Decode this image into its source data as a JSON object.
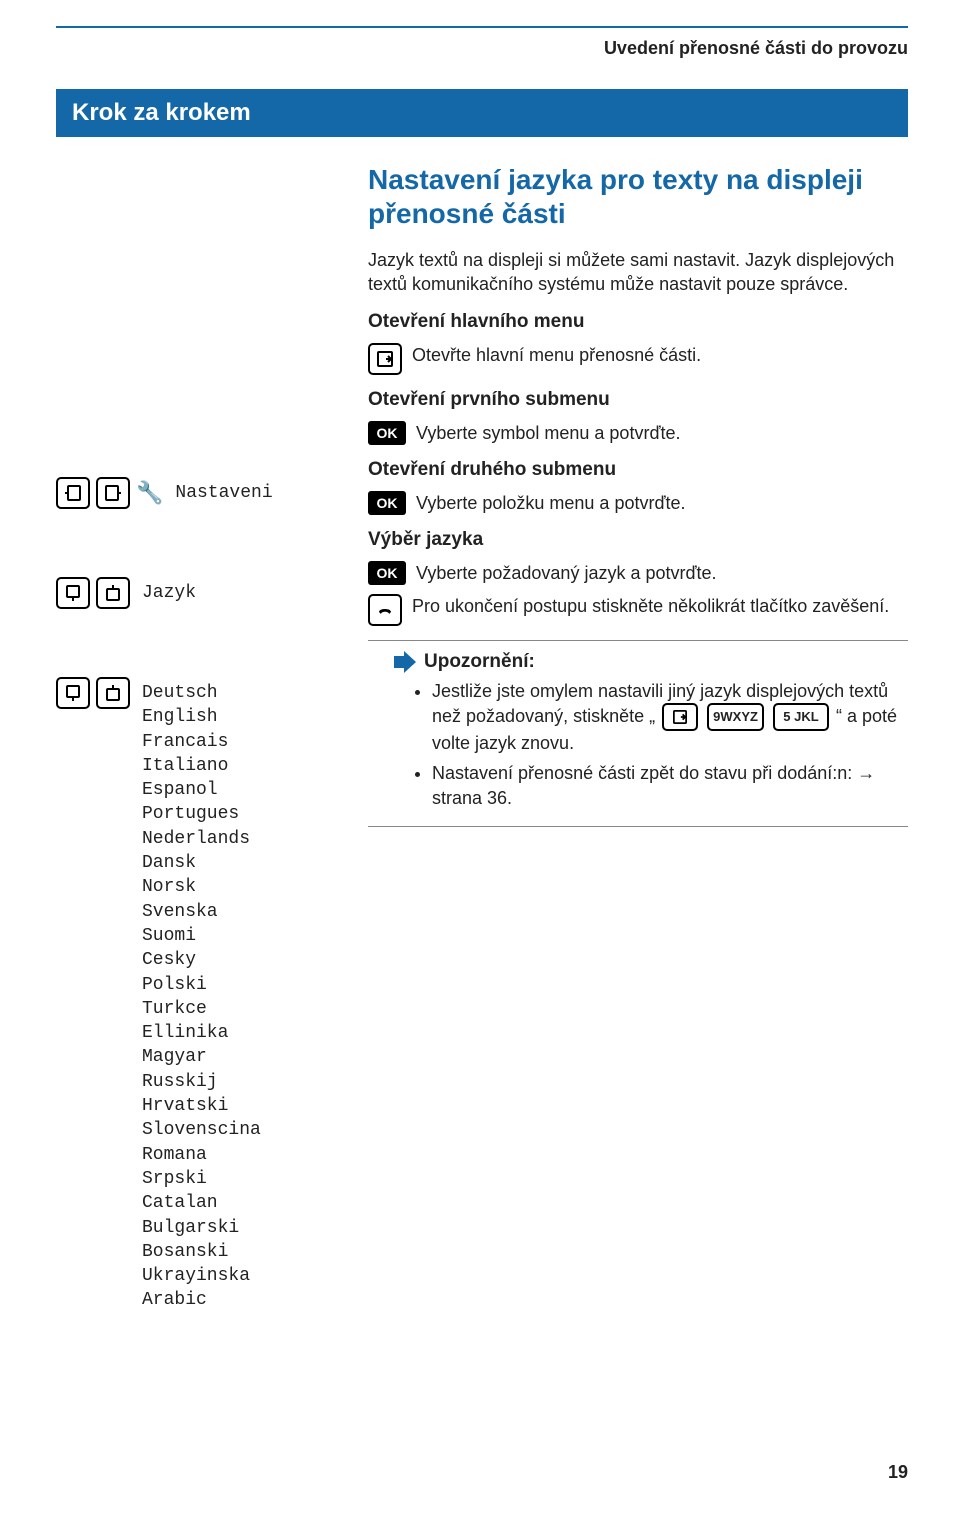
{
  "running_head": "Uvedení přenosné části do provozu",
  "step_banner": "Krok za krokem",
  "title": "Nastavení jazyka pro texty na displeji přenosné části",
  "intro_a": "Jazyk textů na displeji si můžete sami nastavit. Jazyk displejových textů komunikačního systému může nastavit pouze správce.",
  "sec_open_main": "Otevření hlavního menu",
  "open_main_instr": "Otevřte hlavní menu přenosné části.",
  "sec_open_sub1": "Otevření prvního submenu",
  "sub1_instr": "Vyberte symbol menu a potvrďte.",
  "nav_nastaveni": "Nastaveni",
  "sec_open_sub2": "Otevření druhého submenu",
  "nav_jazyk": "Jazyk",
  "sub2_instr": "Vyberte položku menu a potvrďte.",
  "sec_vyber": "Výběr jazyka",
  "vyber_instr": "Vyberte požadovaný jazyk a potvrďte.",
  "end_instr": "Pro ukončení postupu stiskněte několikrát tlačítko zavěšení.",
  "note_title": "Upozornění:",
  "note_b1_a": "Jestliže jste omylem nastavili jiný jazyk displejových textů než požadovaný, stiskněte „",
  "note_b1_b": "“ a poté volte jazyk znovu.",
  "note_b2": "Nastavení přenosné části zpět do stavu při dodání:n: → strana 36.",
  "ok_label": "OK",
  "key_9": "9WXYZ",
  "key_5": "5 JKL",
  "page_number": "19",
  "languages": [
    "Deutsch",
    "English",
    "Francais",
    "Italiano",
    "Espanol",
    "Portugues",
    "Nederlands",
    "Dansk",
    "Norsk",
    "Svenska",
    "Suomi",
    "Cesky",
    "Polski",
    "Turkce",
    "Ellinika",
    "Magyar",
    "Russkij",
    "Hrvatski",
    "Slovenscina",
    "Romana",
    "Srpski",
    "Catalan",
    "Bulgarski",
    "Bosanski",
    "Ukrayinska",
    "Arabic"
  ]
}
